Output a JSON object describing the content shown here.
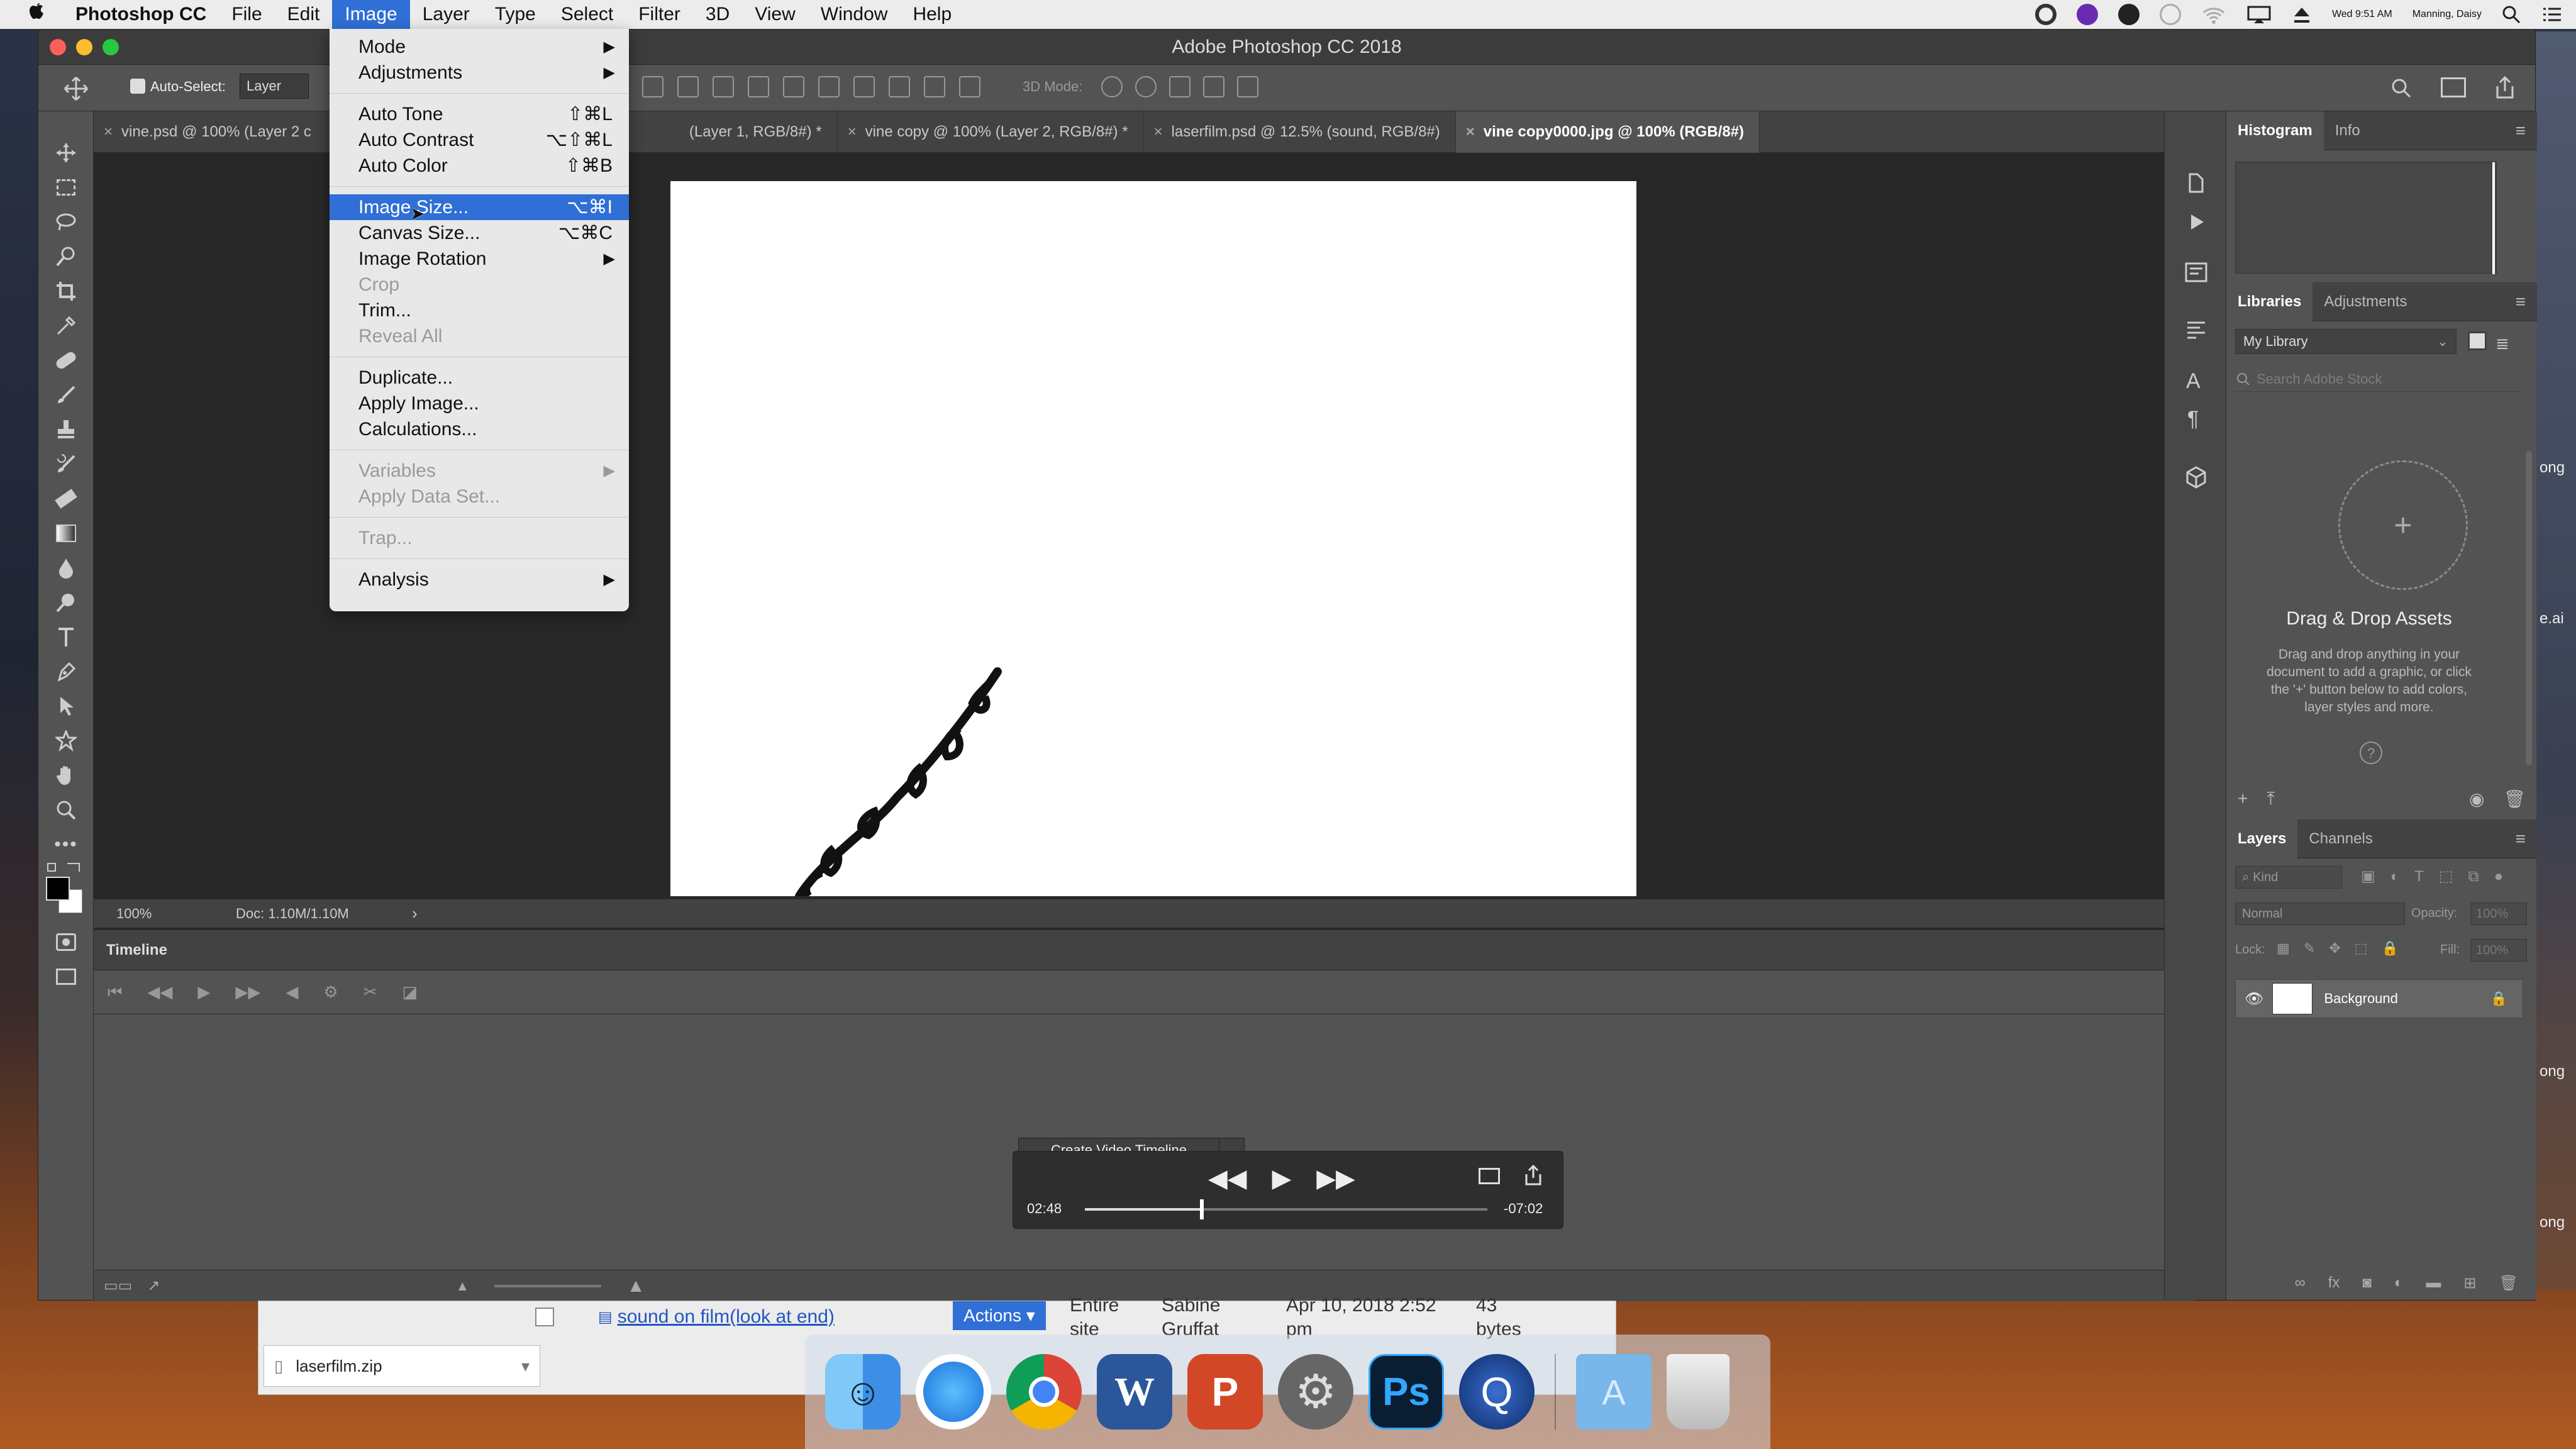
{
  "menubar": {
    "app": "Photoshop CC",
    "items": [
      "File",
      "Edit",
      "Image",
      "Layer",
      "Type",
      "Select",
      "Filter",
      "3D",
      "View",
      "Window",
      "Help"
    ],
    "open_index": 2,
    "clock": "Wed 9:51 AM",
    "user": "Manning, Daisy"
  },
  "window": {
    "title": "Adobe Photoshop CC 2018"
  },
  "options": {
    "autoselect_label": "Auto-Select:",
    "layer_select": "Layer",
    "mode_3d": "3D Mode:"
  },
  "tabs": [
    {
      "label": "vine.psd @ 100% (Layer 2 c",
      "active": false
    },
    {
      "label": "(Layer 1, RGB/8#) *",
      "active": false
    },
    {
      "label": "vine copy @ 100% (Layer 2, RGB/8#) *",
      "active": false
    },
    {
      "label": "laserfilm.psd @ 12.5% (sound, RGB/8#)",
      "active": false
    },
    {
      "label": "vine copy0000.jpg @ 100% (RGB/8#)",
      "active": true
    }
  ],
  "status": {
    "zoom": "100%",
    "doc": "Doc: 1.10M/1.10M"
  },
  "image_menu": {
    "groups": [
      [
        {
          "label": "Mode",
          "sub": true
        },
        {
          "label": "Adjustments",
          "sub": true
        }
      ],
      [
        {
          "label": "Auto Tone",
          "shortcut": "⇧⌘L"
        },
        {
          "label": "Auto Contrast",
          "shortcut": "⌥⇧⌘L"
        },
        {
          "label": "Auto Color",
          "shortcut": "⇧⌘B"
        }
      ],
      [
        {
          "label": "Image Size...",
          "shortcut": "⌥⌘I",
          "selected": true
        },
        {
          "label": "Canvas Size...",
          "shortcut": "⌥⌘C"
        },
        {
          "label": "Image Rotation",
          "sub": true
        },
        {
          "label": "Crop",
          "disabled": true
        },
        {
          "label": "Trim..."
        },
        {
          "label": "Reveal All",
          "disabled": true
        }
      ],
      [
        {
          "label": "Duplicate..."
        },
        {
          "label": "Apply Image..."
        },
        {
          "label": "Calculations..."
        }
      ],
      [
        {
          "label": "Variables",
          "sub": true,
          "disabled": true
        },
        {
          "label": "Apply Data Set...",
          "disabled": true
        }
      ],
      [
        {
          "label": "Trap...",
          "disabled": true
        }
      ],
      [
        {
          "label": "Analysis",
          "sub": true
        }
      ]
    ]
  },
  "timeline": {
    "title": "Timeline",
    "create_button": "Create Video Timeline"
  },
  "player": {
    "elapsed": "02:48",
    "remaining": "-07:02",
    "progress": 0.29
  },
  "panels": {
    "histogram_tabs": [
      "Histogram",
      "Info"
    ],
    "library_tabs": [
      "Libraries",
      "Adjustments"
    ],
    "library_name": "My Library",
    "search_placeholder": "Search Adobe Stock",
    "drag_title": "Drag & Drop Assets",
    "drag_desc": "Drag and drop anything in your document to add a graphic, or click the '+' button below to add colors, layer styles and more.",
    "layers_tabs": [
      "Layers",
      "Channels"
    ],
    "kind_label": "Kind",
    "blend_mode": "Normal",
    "opacity_label": "Opacity:",
    "opacity_value": "100%",
    "lock_label": "Lock:",
    "fill_label": "Fill:",
    "fill_value": "100%",
    "layer_name": "Background"
  },
  "finder": {
    "file_label": "sound on film(look at end)",
    "actions": "Actions",
    "scope": "Entire site",
    "owner": "Sabine Gruffat",
    "date": "Apr 10, 2018 2:52 pm",
    "size": "43 bytes",
    "download": "laserfilm.zip"
  },
  "desktop_labels": [
    "ong",
    "e.ai",
    "ong",
    "ong"
  ],
  "colors": {
    "accent": "#2f6fd6",
    "ps_bg": "#535353",
    "ps_dark": "#424242"
  }
}
